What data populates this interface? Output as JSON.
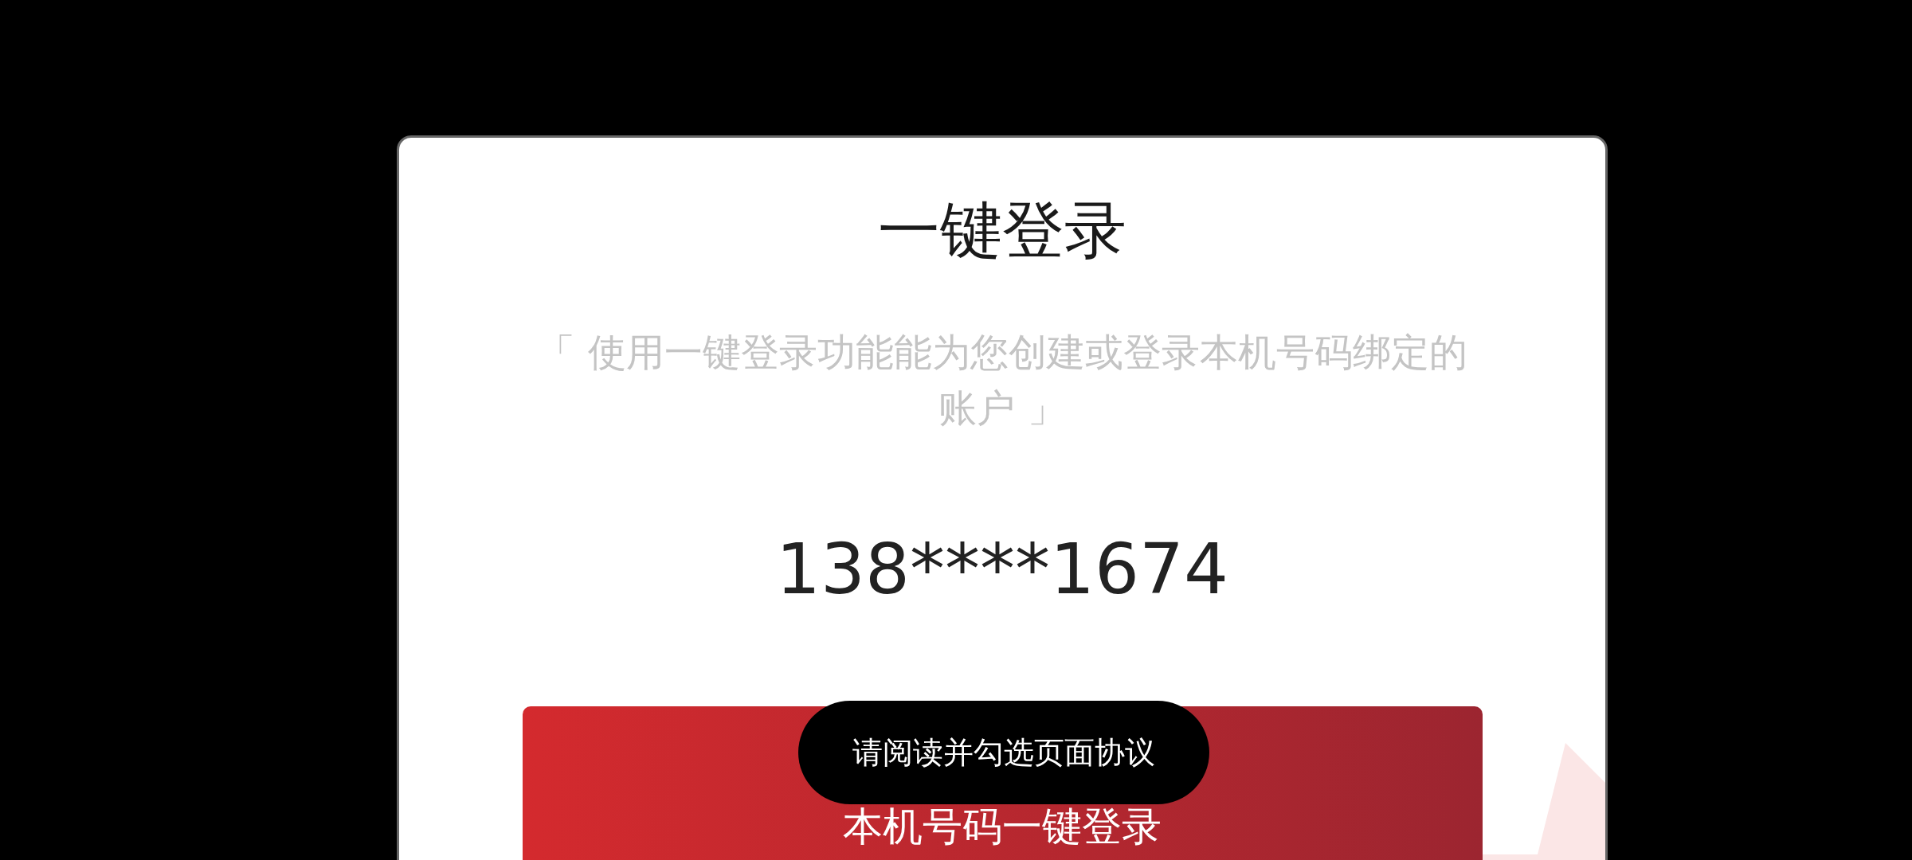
{
  "dialog": {
    "title": "一键登录",
    "description": "「 使用一键登录功能能为您创建或登录本机号码绑定的账户 」",
    "phone_number": "138****1674",
    "login_button": "本机号码一键登录"
  },
  "toast": {
    "message": "请阅读并勾选页面协议"
  }
}
